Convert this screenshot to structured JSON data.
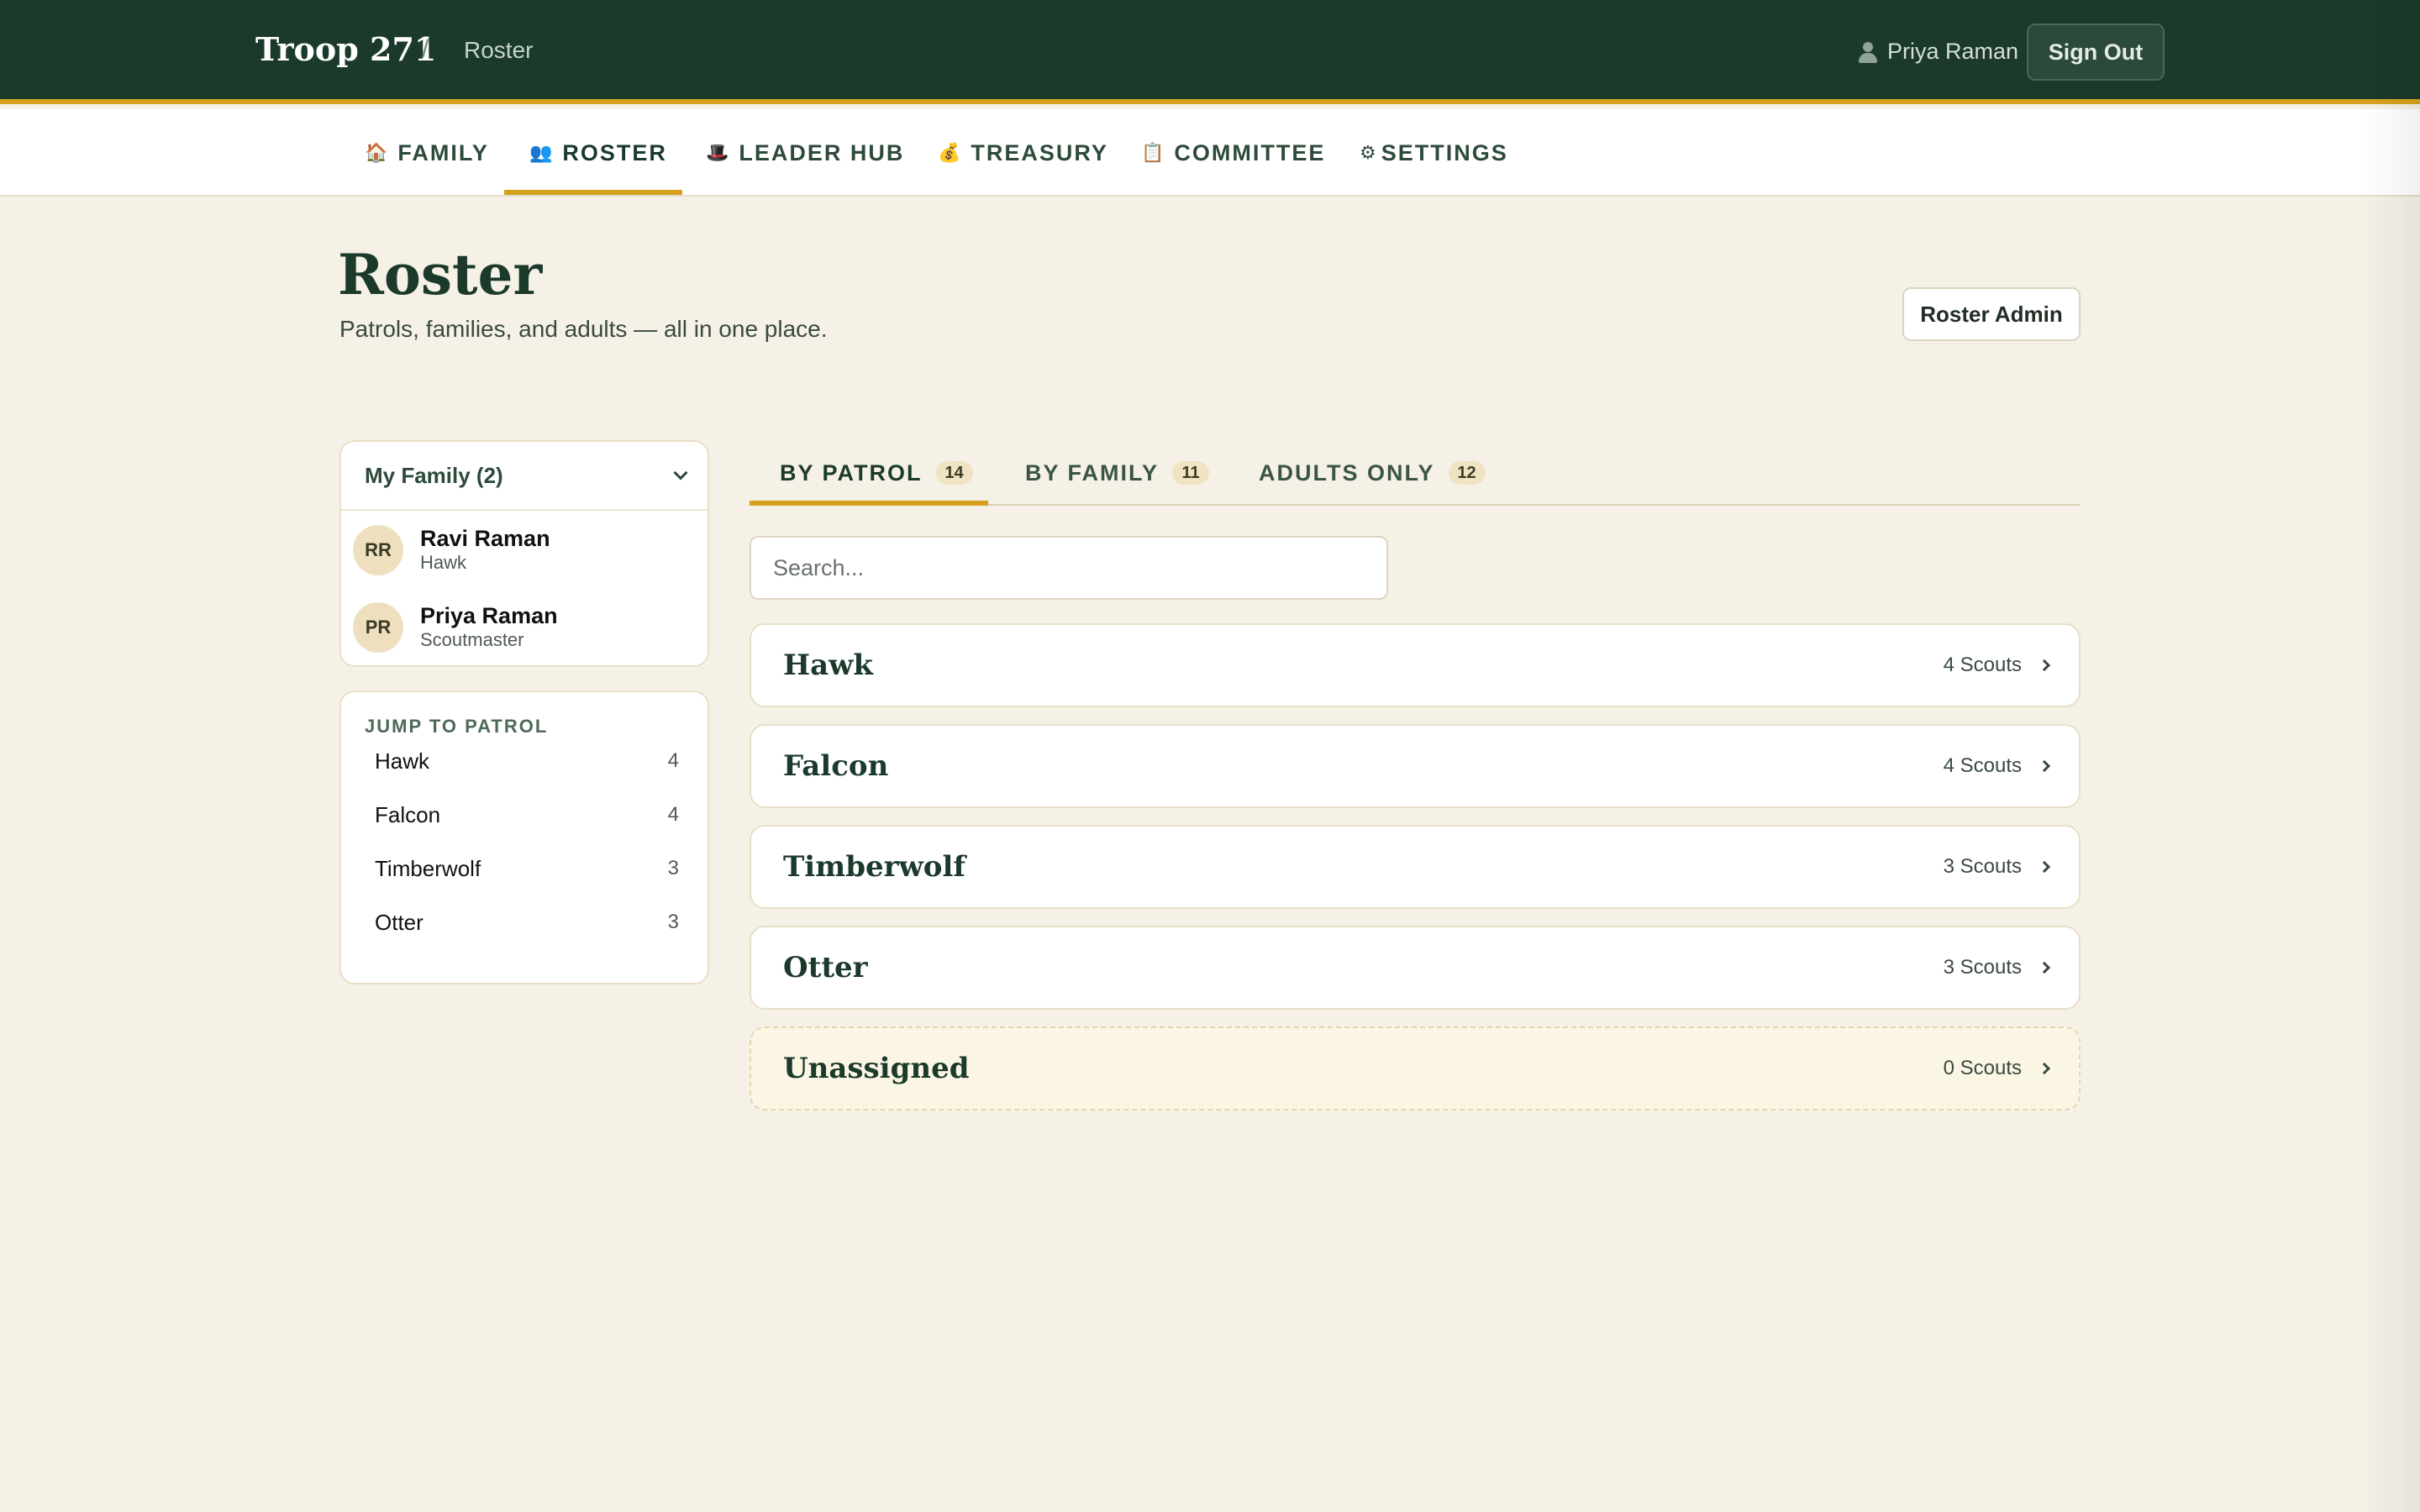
{
  "header": {
    "brand": "Troop 271",
    "separator": "/",
    "breadcrumb": "Roster",
    "user_name": "Priya Raman",
    "sign_out_label": "Sign Out"
  },
  "nav": {
    "items": [
      {
        "icon": "🏠",
        "label": "FAMILY"
      },
      {
        "icon": "👥",
        "label": "ROSTER",
        "active": true
      },
      {
        "icon": "🎩",
        "label": "LEADER HUB"
      },
      {
        "icon": "💰",
        "label": "TREASURY"
      },
      {
        "icon": "📋",
        "label": "COMMITTEE"
      },
      {
        "icon": "⚙",
        "label": "SETTINGS"
      }
    ]
  },
  "page": {
    "title": "Roster",
    "subtitle": "Patrols, families, and adults — all in one place.",
    "admin_button": "Roster Admin"
  },
  "family": {
    "header": "My Family (2)",
    "members": [
      {
        "initials": "RR",
        "name": "Ravi Raman",
        "role": "Hawk"
      },
      {
        "initials": "PR",
        "name": "Priya Raman",
        "role": "Scoutmaster"
      }
    ]
  },
  "jump": {
    "title": "JUMP TO PATROL",
    "items": [
      {
        "name": "Hawk",
        "count": "4"
      },
      {
        "name": "Falcon",
        "count": "4"
      },
      {
        "name": "Timberwolf",
        "count": "3"
      },
      {
        "name": "Otter",
        "count": "3"
      }
    ]
  },
  "tabs": [
    {
      "label": "BY PATROL",
      "count": "14",
      "active": true
    },
    {
      "label": "BY FAMILY",
      "count": "11"
    },
    {
      "label": "ADULTS ONLY",
      "count": "12"
    }
  ],
  "search": {
    "placeholder": "Search..."
  },
  "patrols": [
    {
      "name": "Hawk",
      "count": "4 Scouts"
    },
    {
      "name": "Falcon",
      "count": "4 Scouts"
    },
    {
      "name": "Timberwolf",
      "count": "3 Scouts"
    },
    {
      "name": "Otter",
      "count": "3 Scouts"
    },
    {
      "name": "Unassigned",
      "count": "0 Scouts"
    }
  ],
  "colors": {
    "header_bg": "#1b3a2b",
    "accent": "#d6a21e",
    "page_bg": "#f5f1e7"
  }
}
